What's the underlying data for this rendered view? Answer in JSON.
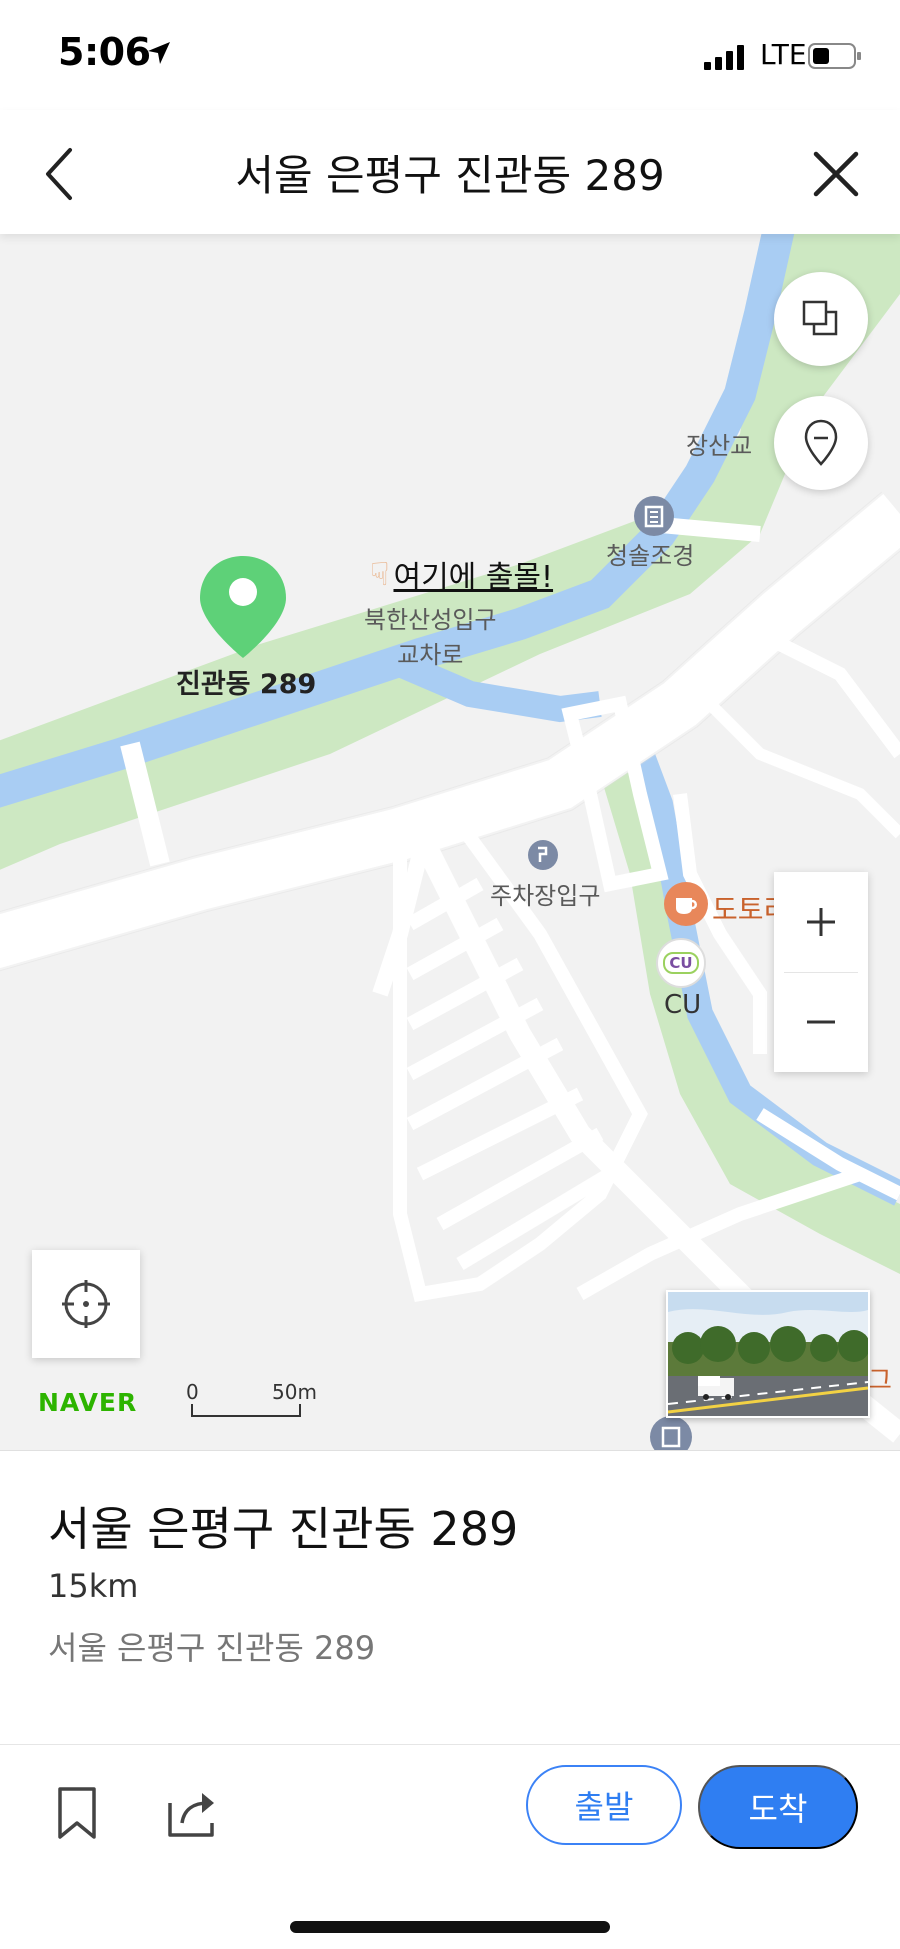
{
  "status_bar": {
    "time": "5:06",
    "network": "LTE"
  },
  "nav": {
    "title": "서울 은평구 진관동 289"
  },
  "map": {
    "labels": {
      "pin_label": "진관동 289",
      "annotation": "여기에 출몰!",
      "bridge": "장산교",
      "landscape": "청솔조경",
      "intersection_line1": "북한산성입구",
      "intersection_line2": "교차로",
      "parking": "주차장입구",
      "cafe": "도토리카페",
      "store_badge": "CU",
      "store": "CU",
      "edge_partial": "그"
    },
    "logo": "NAVER",
    "scale": {
      "zero": "0",
      "distance": "50m"
    },
    "colors": {
      "water": "#a9cdf3",
      "park": "#cde8c2",
      "road": "#ffffff",
      "pin": "#5ed178",
      "cafe": "#e8875a",
      "poi": "#7c8aa5"
    }
  },
  "place": {
    "name": "서울 은평구 진관동 289",
    "distance": "15km",
    "address": "서울 은평구 진관동 289"
  },
  "actions": {
    "depart_label": "출발",
    "arrive_label": "도착"
  }
}
